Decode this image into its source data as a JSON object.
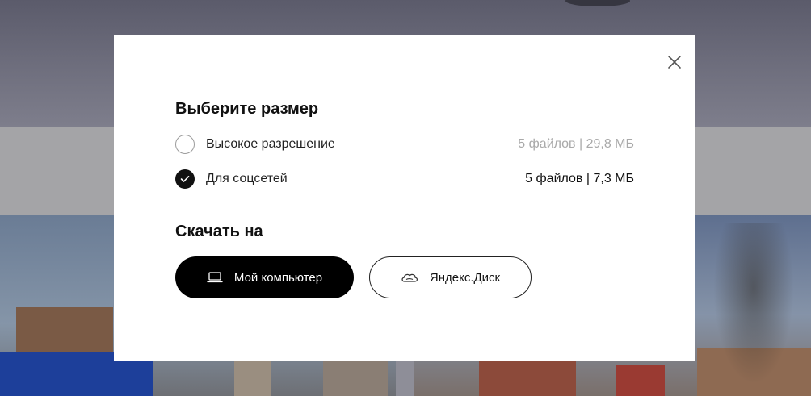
{
  "modal": {
    "size_heading": "Выберите размер",
    "options": [
      {
        "label": "Высокое разрешение",
        "meta": "5 файлов | 29,8 МБ",
        "selected": false
      },
      {
        "label": "Для соцсетей",
        "meta": "5 файлов | 7,3 МБ",
        "selected": true
      }
    ],
    "download_heading": "Скачать на",
    "buttons": {
      "computer": {
        "label": "Мой компьютер",
        "icon": "laptop-icon"
      },
      "disk": {
        "label": "Яндекс.Диск",
        "icon": "cloud-icon"
      }
    },
    "close_icon": "close-icon"
  },
  "colors": {
    "primary_button_bg": "#000000",
    "annotation_mark": "#e0141e"
  }
}
